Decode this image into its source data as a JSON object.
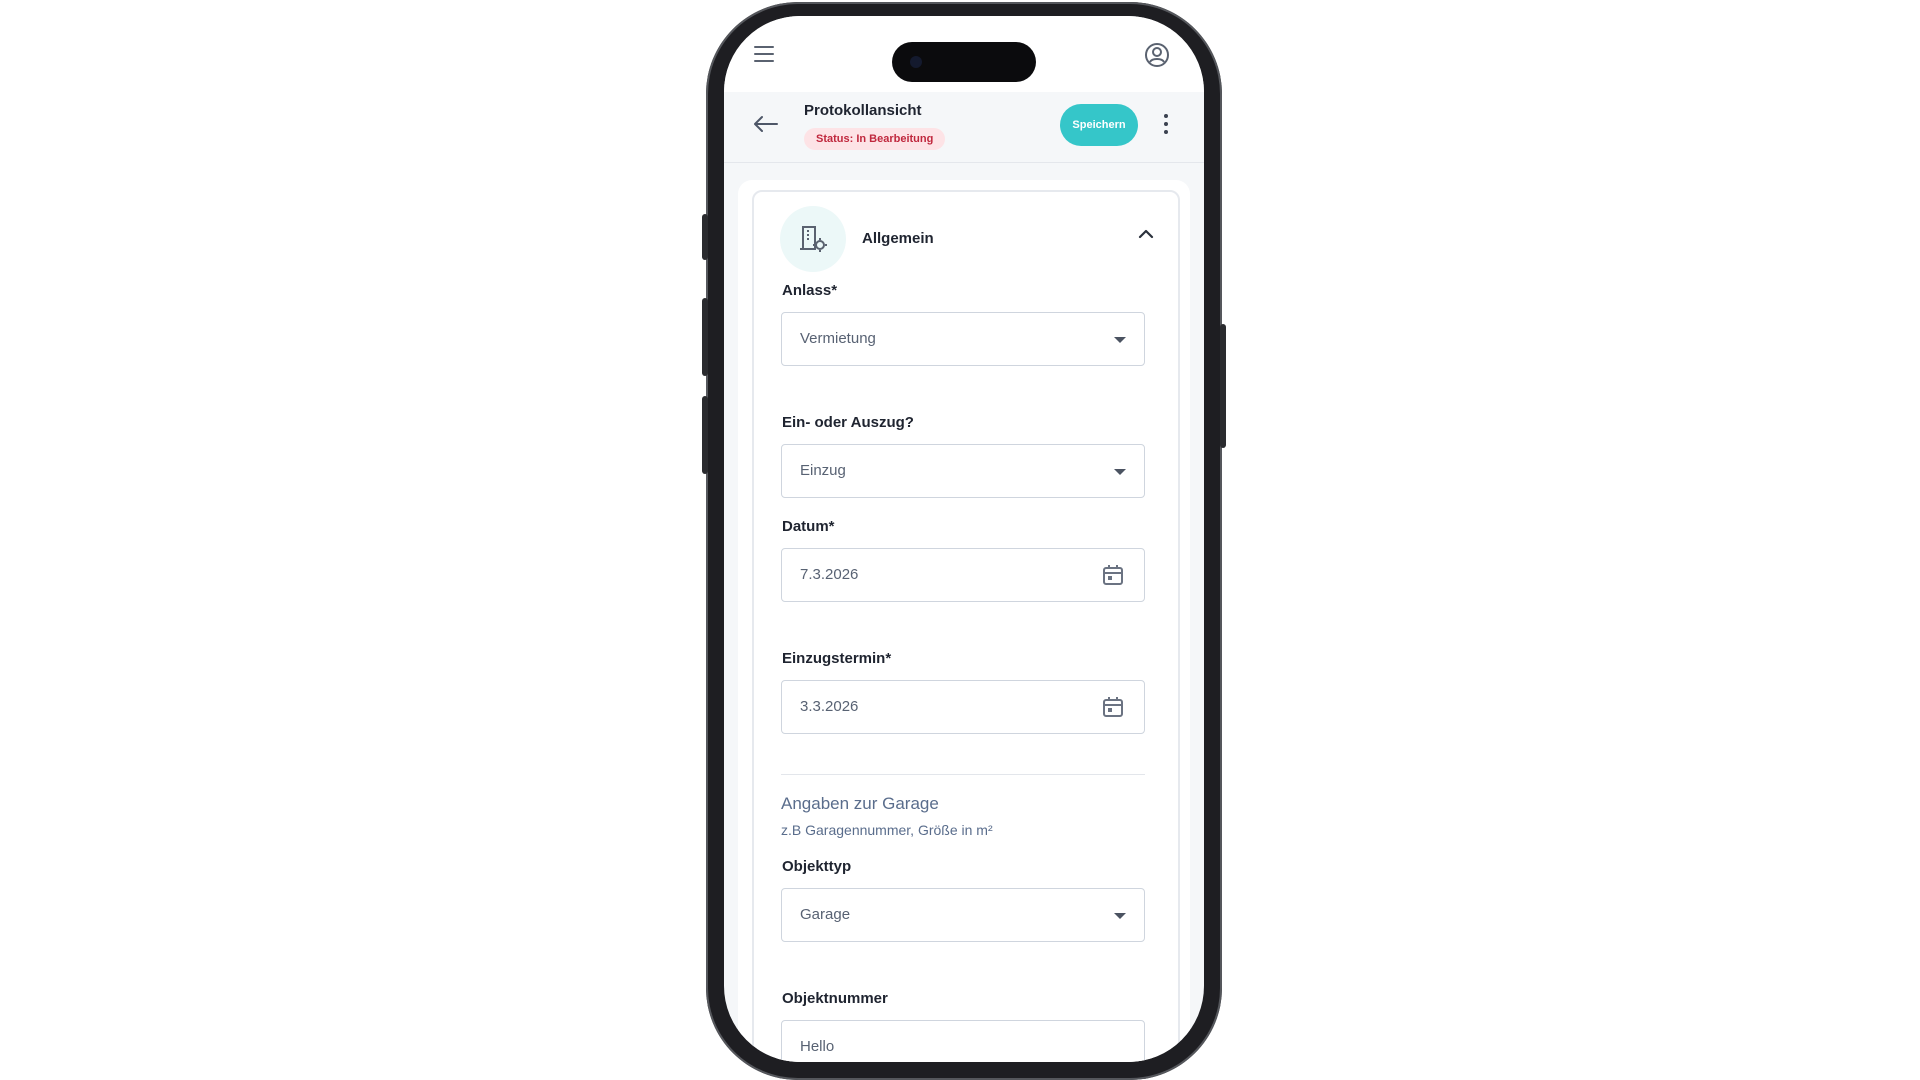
{
  "header": {
    "title": "Protokollansicht",
    "status_label": "Status: In Bearbeitung",
    "save_label": "Speichern"
  },
  "section": {
    "title": "Allgemein",
    "icon": "building-settings-icon"
  },
  "fields": {
    "anlass": {
      "label": "Anlass*",
      "value": "Vermietung"
    },
    "ein_auszug": {
      "label": "Ein- oder Auszug?",
      "value": "Einzug"
    },
    "datum": {
      "label": "Datum*",
      "value": "7.3.2026"
    },
    "einzugstermin": {
      "label": "Einzugstermin*",
      "value": "3.3.2026"
    }
  },
  "garage": {
    "heading": "Angaben zur Garage",
    "subtitle": "z.B Garagennummer, Größe in m²",
    "objekttyp": {
      "label": "Objekttyp",
      "value": "Garage"
    },
    "objektnummer": {
      "label": "Objektnummer",
      "value": "Hello"
    }
  },
  "colors": {
    "accent": "#35c6c9",
    "status_bg": "#fde3e6",
    "status_text": "#c0283e"
  }
}
